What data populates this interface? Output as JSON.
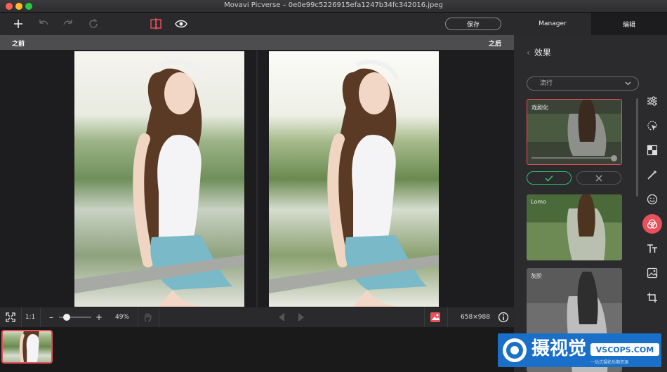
{
  "window": {
    "title": "Movavi Picverse – 0e0e99c5226915efa1247b34fc342016.jpeg"
  },
  "toolbar": {
    "save_label": "保存"
  },
  "right_tabs": [
    {
      "label": "Manager"
    },
    {
      "label": "编辑"
    }
  ],
  "compare": {
    "before_label": "之前",
    "after_label": "之后"
  },
  "bottombar": {
    "ratio_label": "1:1",
    "minus": "–",
    "plus": "+",
    "zoom": "49%",
    "zoom_fraction": 0.18,
    "dimensions": "658×988",
    "info": "i"
  },
  "sidepanel": {
    "back_chevron": "‹",
    "title": "效果",
    "dropdown_value": "流行",
    "cards": [
      {
        "label": "戏剧化"
      },
      {
        "label": "Lomo"
      },
      {
        "label": "灰阶"
      }
    ]
  },
  "watermark": {
    "text": "摄视觉",
    "domain": "VSCOPS.COM",
    "tagline": "一站式摄影后期资源"
  },
  "colors": {
    "accent": "#e8505b",
    "confirm": "#2fbf71",
    "panel": "#2b2b2d"
  },
  "icons": [
    "plus-icon",
    "undo-icon",
    "redo-icon",
    "rotate-icon",
    "compare-icon",
    "eye-icon",
    "fullscreen-icon",
    "hand-icon",
    "prev-icon",
    "next-icon",
    "image-icon",
    "info-icon",
    "adjust-icon",
    "select-icon",
    "retouch-icon",
    "magic-icon",
    "face-icon",
    "effects-icon",
    "text-icon",
    "picture-icon",
    "crop-icon",
    "check-icon",
    "close-icon",
    "chevron-down-icon"
  ]
}
